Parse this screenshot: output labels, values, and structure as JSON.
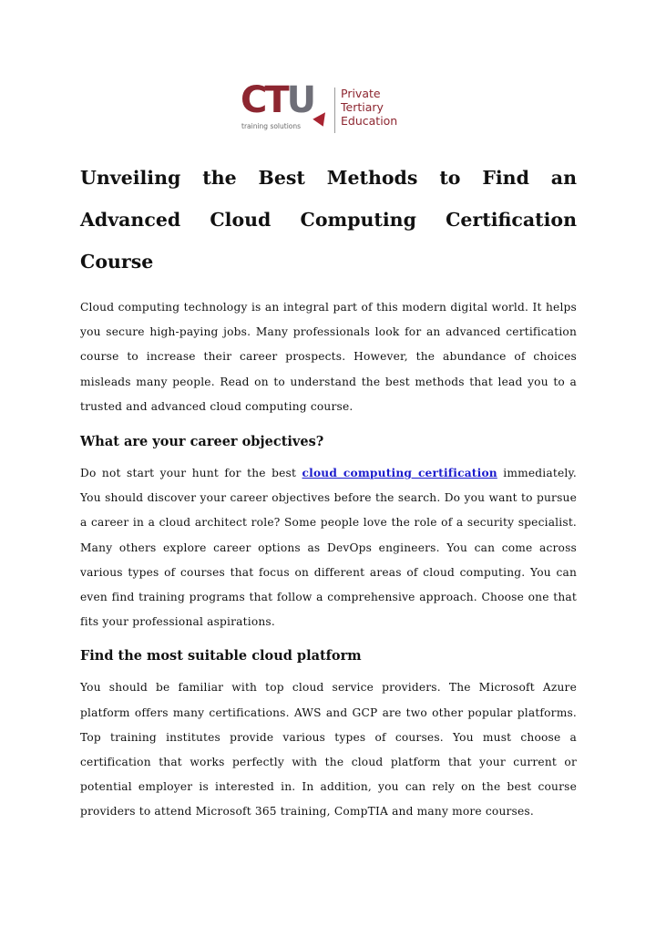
{
  "logo": {
    "brand_c": "C",
    "brand_t": "T",
    "brand_u": "U",
    "tagline": "training solutions",
    "side_text_lines": [
      "Private",
      "Tertiary",
      "Education"
    ],
    "colors": {
      "primary": "#8d2630",
      "secondary": "#6f6f78"
    }
  },
  "title": {
    "line1": "Unveiling the Best Methods to Find an",
    "line2": "Advanced Cloud Computing Certification Course"
  },
  "intro": "Cloud computing technology is an integral part of this modern digital world. It helps you secure high-paying jobs. Many professionals look for an advanced certification course to increase their career prospects. However, the abundance of choices misleads many people. Read on to understand the best methods that lead you to a trusted and advanced cloud computing course.",
  "sections": [
    {
      "heading": "What are your career objectives?",
      "before_link": "Do not start your hunt for the best ",
      "link_text": "cloud computing certification",
      "after_link": " immediately. You should discover your career objectives before the search. Do you want to pursue a career in a cloud architect role? Some people love the role of a security specialist. Many others explore career options as DevOps engineers.  You can come across various types of courses that focus on different areas of cloud computing. You can even find training programs that follow a comprehensive approach. Choose one that fits your professional aspirations."
    },
    {
      "heading": "Find the most suitable cloud platform",
      "body": "You should be familiar with top cloud service providers. The Microsoft Azure platform offers many certifications. AWS and GCP are two other popular platforms. Top training institutes provide various types of courses. You must choose a certification that works perfectly with the cloud platform that your current or potential employer is interested in. In addition, you can rely on the best course providers to attend Microsoft 365 training, CompTIA and many more courses."
    }
  ],
  "link_color": "#1a1acc"
}
